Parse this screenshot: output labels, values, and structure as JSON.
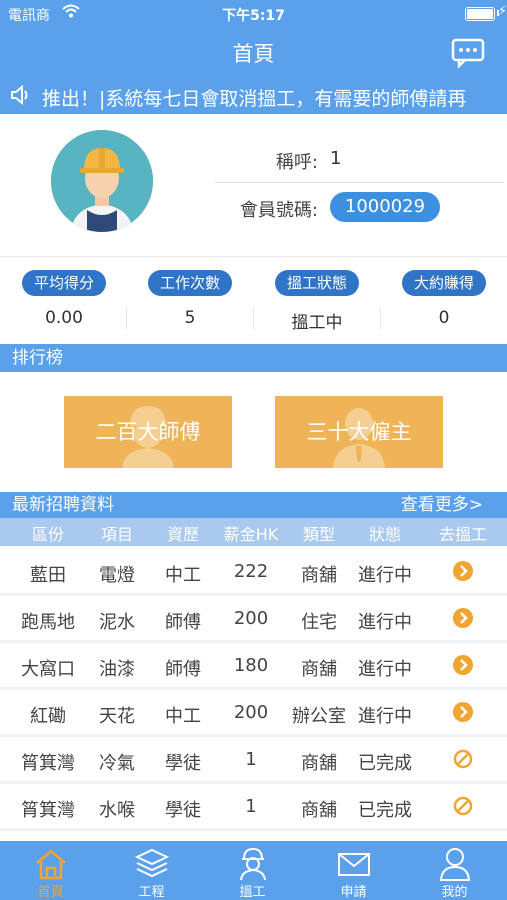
{
  "status_bar": {
    "carrier": "電訊商",
    "time": "下午5:17"
  },
  "nav": {
    "title": "首頁"
  },
  "notice": {
    "text": "推出！|系統每七日會取消搵工，有需要的師傅請再"
  },
  "profile": {
    "name_label": "稱呼:",
    "name_value": "1",
    "member_label": "會員號碼:",
    "member_value": "1000029"
  },
  "stats": [
    {
      "label": "平均得分",
      "value": "0.00"
    },
    {
      "label": "工作次數",
      "value": "5"
    },
    {
      "label": "搵工狀態",
      "value": "搵工中"
    },
    {
      "label": "大約賺得",
      "value": "0"
    }
  ],
  "ranking": {
    "title": "排行榜",
    "workers_button": "二百大師傅",
    "employers_button": "三十大僱主"
  },
  "jobs": {
    "title": "最新招聘資料",
    "more": "查看更多>",
    "columns": [
      "區份",
      "項目",
      "資歷",
      "薪金HK",
      "類型",
      "狀態",
      "去搵工"
    ],
    "rows": [
      {
        "area": "藍田",
        "item": "電燈",
        "level": "中工",
        "salary": "222",
        "type": "商舖",
        "status": "進行中",
        "action": "go"
      },
      {
        "area": "跑馬地",
        "item": "泥水",
        "level": "師傅",
        "salary": "200",
        "type": "住宅",
        "status": "進行中",
        "action": "go"
      },
      {
        "area": "大窩口",
        "item": "油漆",
        "level": "師傅",
        "salary": "180",
        "type": "商舖",
        "status": "進行中",
        "action": "go"
      },
      {
        "area": "紅磡",
        "item": "天花",
        "level": "中工",
        "salary": "200",
        "type": "辦公室",
        "status": "進行中",
        "action": "go"
      },
      {
        "area": "筲箕灣",
        "item": "冷氣",
        "level": "學徒",
        "salary": "1",
        "type": "商舖",
        "status": "已完成",
        "action": "closed"
      },
      {
        "area": "筲箕灣",
        "item": "水喉",
        "level": "學徒",
        "salary": "1",
        "type": "商舖",
        "status": "已完成",
        "action": "closed"
      }
    ]
  },
  "tabs": [
    {
      "label": "首頁",
      "icon": "home-icon",
      "active": true
    },
    {
      "label": "工程",
      "icon": "layers-icon",
      "active": false
    },
    {
      "label": "搵工",
      "icon": "worker-icon",
      "active": false
    },
    {
      "label": "申請",
      "icon": "mail-icon",
      "active": false
    },
    {
      "label": "我的",
      "icon": "user-icon",
      "active": false
    }
  ],
  "colors": {
    "primary": "#5aa0ea",
    "badge": "#2f74c6",
    "accent": "#f0a531",
    "rank_button": "#f0b458"
  }
}
